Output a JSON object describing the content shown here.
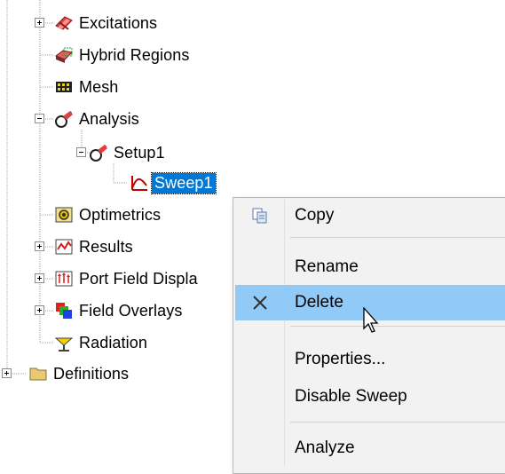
{
  "tree": {
    "items": [
      {
        "label": "Excitations"
      },
      {
        "label": "Hybrid Regions"
      },
      {
        "label": "Mesh"
      },
      {
        "label": "Analysis"
      },
      {
        "label": "Setup1"
      },
      {
        "label": "Sweep1"
      },
      {
        "label": "Optimetrics"
      },
      {
        "label": "Results"
      },
      {
        "label": "Port Field Displa"
      },
      {
        "label": "Field Overlays"
      },
      {
        "label": "Radiation"
      },
      {
        "label": "Definitions"
      }
    ]
  },
  "context_menu": {
    "items": [
      {
        "label": "Copy",
        "icon": "copy-icon"
      },
      {
        "label": "Rename"
      },
      {
        "label": "Delete",
        "icon": "delete-x-icon"
      },
      {
        "label": "Properties..."
      },
      {
        "label": "Disable Sweep"
      },
      {
        "label": "Analyze"
      }
    ]
  },
  "colors": {
    "selection": "#0078d7",
    "menu_hover": "#91c9f7",
    "menu_bg": "#f2f2f2"
  }
}
